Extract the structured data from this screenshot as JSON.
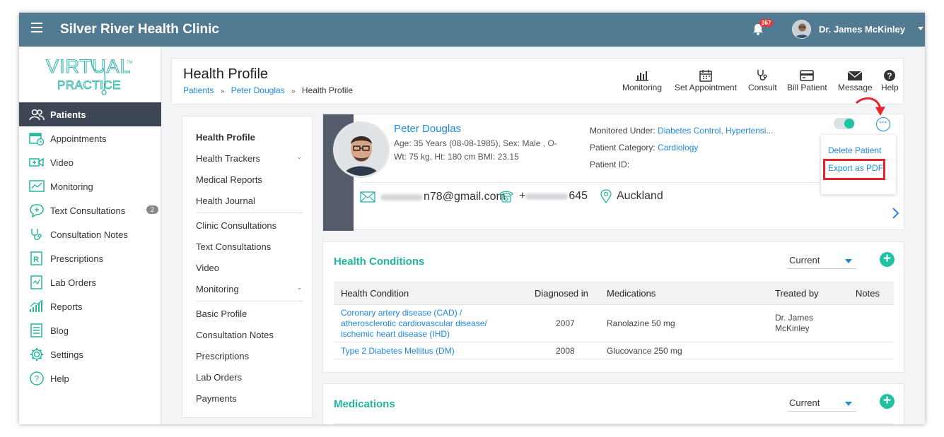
{
  "topbar": {
    "clinic_name": "Silver River Health Clinic",
    "notification_count": "367",
    "user_name": "Dr. James McKinley",
    "bar_color": "#527a92"
  },
  "logo": {
    "line1": "VIRTUAL",
    "line2": "PRACTICE",
    "tm": "TM"
  },
  "sidebar": {
    "items": [
      {
        "label": "Patients",
        "icon": "patients-icon",
        "active": true
      },
      {
        "label": "Appointments",
        "icon": "calendar-icon"
      },
      {
        "label": "Video",
        "icon": "video-icon"
      },
      {
        "label": "Monitoring",
        "icon": "monitoring-icon"
      },
      {
        "label": "Text Consultations",
        "icon": "chat-icon",
        "count": "2"
      },
      {
        "label": "Consultation Notes",
        "icon": "stethoscope-icon"
      },
      {
        "label": "Prescriptions",
        "icon": "rx-icon"
      },
      {
        "label": "Lab Orders",
        "icon": "lab-icon"
      },
      {
        "label": "Reports",
        "icon": "reports-icon"
      },
      {
        "label": "Blog",
        "icon": "blog-icon"
      },
      {
        "label": "Settings",
        "icon": "gear-icon"
      },
      {
        "label": "Help",
        "icon": "help-icon"
      }
    ]
  },
  "header": {
    "title": "Health Profile",
    "breadcrumb": [
      "Patients",
      "Peter Douglas",
      "Health Profile"
    ],
    "breadcrumb_sep": "»",
    "actions": [
      {
        "label": "Monitoring",
        "icon": "bar-chart-icon"
      },
      {
        "label": "Set Appointment",
        "icon": "calendar-icon"
      },
      {
        "label": "Consult",
        "icon": "stethoscope-icon"
      },
      {
        "label": "Bill Patient",
        "icon": "card-icon"
      },
      {
        "label": "Message",
        "icon": "envelope-icon"
      },
      {
        "label": "Help",
        "icon": "question-icon"
      }
    ]
  },
  "subnav": {
    "items": [
      "Health Profile",
      "Health Trackers",
      "Medical Reports",
      "Health Journal",
      "Clinic Consultations",
      "Text Consultations",
      "Video",
      "Monitoring",
      "Basic Profile",
      "Consultation Notes",
      "Prescriptions",
      "Lab Orders",
      "Payments"
    ]
  },
  "patient": {
    "name": "Peter Douglas",
    "line1": "Age: 35 Years (08-08-1985), Sex: Male , O-",
    "line2": "Wt: 75 kg, Ht: 180 cm BMI: 23.15",
    "monitored_label": "Monitored Under:",
    "monitored_value": "Diabetes Control, Hypertensi...",
    "category_label": "Patient Category:",
    "category_value": "Cardiology",
    "id_label": "Patient ID:",
    "email_suffix": "n78@gmail.com",
    "phone_prefix": "+",
    "phone_suffix": "645",
    "city": "Auckland",
    "more": "···"
  },
  "more_menu": {
    "delete": "Delete Patient",
    "export": "Export as PDF"
  },
  "conditions": {
    "title": "Health Conditions",
    "filter": "Current",
    "add": "+",
    "columns": [
      "Health Condition",
      "Diagnosed in",
      "Medications",
      "Treated by",
      "Notes"
    ],
    "rows": [
      {
        "condition_l1": "Coronary artery disease (CAD) /",
        "condition_l2": "atherosclerotic cardiovascular disease/",
        "condition_l3": "ischemic heart disease (IHD)",
        "year": "2007",
        "med": "Ranolazine 50 mg",
        "doc_l1": "Dr. James",
        "doc_l2": "McKinley"
      },
      {
        "condition_l1": "Type 2 Diabetes Mellitus (DM)",
        "year": "2008",
        "med": "Glucovance 250 mg"
      }
    ]
  },
  "medications": {
    "title": "Medications",
    "filter": "Current",
    "add": "+"
  },
  "colors": {
    "accent": "#1fb5a0",
    "link": "#1e88e5",
    "highlight": "#e8232a"
  }
}
